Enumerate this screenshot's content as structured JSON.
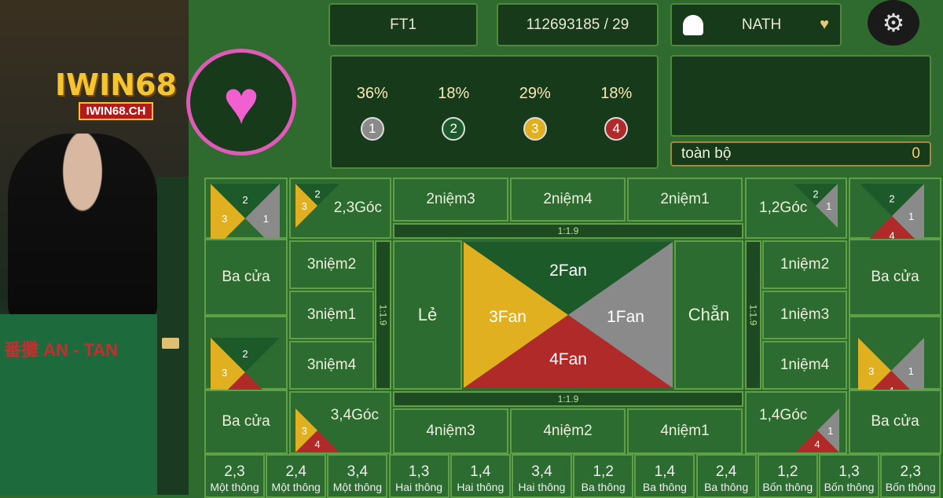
{
  "video": {
    "table_text": "番攤 AN - TAN",
    "logo": {
      "main": "IWIN68",
      "sub": "IWIN68.CH"
    }
  },
  "header": {
    "table_id": "FT1",
    "round": "112693185 / 29",
    "user": "NATH"
  },
  "selected_suit": "heart",
  "stats": [
    {
      "pct": "36%",
      "num": "1",
      "color": "#8a8a8a"
    },
    {
      "pct": "18%",
      "num": "2",
      "color": "#1d5a2a"
    },
    {
      "pct": "29%",
      "num": "3",
      "color": "#e0b020"
    },
    {
      "pct": "18%",
      "num": "4",
      "color": "#b02a2a"
    }
  ],
  "total": {
    "label": "toàn bộ",
    "value": "0"
  },
  "board": {
    "top": [
      "2niệm3",
      "2niệm4",
      "2niệm1"
    ],
    "left": [
      "3niệm2",
      "3niệm1",
      "3niệm4"
    ],
    "right": [
      "1niệm2",
      "1niệm3",
      "1niệm4"
    ],
    "bottom": [
      "4niệm3",
      "4niệm2",
      "4niệm1"
    ],
    "odd": "Lẻ",
    "even": "Chẵn",
    "fan": {
      "f1": "1Fan",
      "f2": "2Fan",
      "f3": "3Fan",
      "f4": "4Fan"
    },
    "ratio": "1:1.9",
    "ba_cua": "Ba cửa",
    "corners": {
      "c23": "2,3Góc",
      "c12": "1,2Góc",
      "c34": "3,4Góc",
      "c14": "1,4Góc"
    },
    "tri_labels": {
      "n1": "1",
      "n2": "2",
      "n3": "3",
      "n4": "4"
    }
  },
  "bottom_row": [
    {
      "n": "2,3",
      "l": "Một thông"
    },
    {
      "n": "2,4",
      "l": "Một thông"
    },
    {
      "n": "3,4",
      "l": "Một thông"
    },
    {
      "n": "1,3",
      "l": "Hai thông"
    },
    {
      "n": "1,4",
      "l": "Hai thông"
    },
    {
      "n": "3,4",
      "l": "Hai thông"
    },
    {
      "n": "1,2",
      "l": "Ba thông"
    },
    {
      "n": "1,4",
      "l": "Ba thông"
    },
    {
      "n": "2,4",
      "l": "Ba thông"
    },
    {
      "n": "1,2",
      "l": "Bốn thông"
    },
    {
      "n": "1,3",
      "l": "Bốn thông"
    },
    {
      "n": "2,3",
      "l": "Bốn thông"
    }
  ],
  "colors": {
    "fan1": "#8a8a8a",
    "fan2": "#1d5a2a",
    "fan3": "#e0b020",
    "fan4": "#b02a2a",
    "felt": "#2f6a2e"
  }
}
